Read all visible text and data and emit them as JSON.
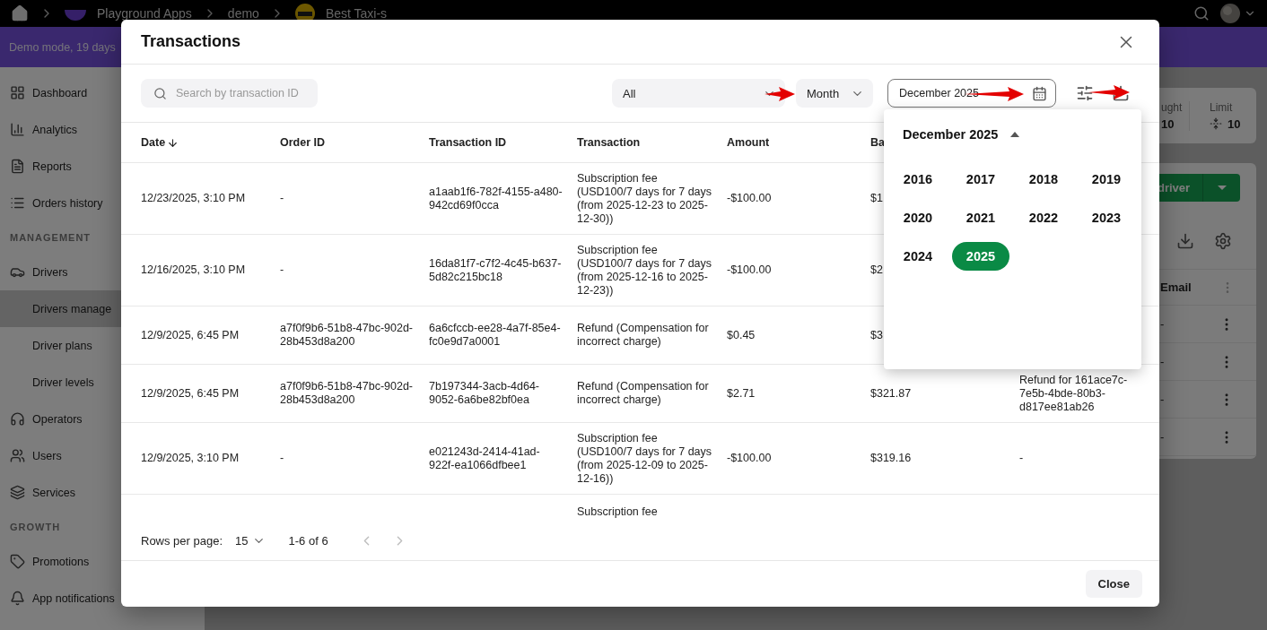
{
  "topbar": {
    "breadcrumbs": [
      {
        "label": "Playground Apps",
        "kind": "org"
      },
      {
        "label": "demo",
        "kind": "text"
      },
      {
        "label": "Best Taxi-s",
        "kind": "app"
      }
    ]
  },
  "banner": {
    "text": "Demo mode, 19 days"
  },
  "sidebar": {
    "items": [
      {
        "kind": "item",
        "label": "Dashboard",
        "selected": false
      },
      {
        "kind": "item",
        "label": "Analytics",
        "selected": false
      },
      {
        "kind": "item",
        "label": "Reports",
        "selected": false
      },
      {
        "kind": "item",
        "label": "Orders history",
        "selected": false
      },
      {
        "kind": "heading",
        "label": "MANAGEMENT"
      },
      {
        "kind": "item",
        "label": "Drivers",
        "selected": false
      },
      {
        "kind": "subitem",
        "label": "Drivers manage",
        "selected": true
      },
      {
        "kind": "subitem",
        "label": "Driver plans",
        "selected": false
      },
      {
        "kind": "subitem",
        "label": "Driver levels",
        "selected": false
      },
      {
        "kind": "item",
        "label": "Operators",
        "selected": false
      },
      {
        "kind": "item",
        "label": "Users",
        "selected": false
      },
      {
        "kind": "item",
        "label": "Services",
        "selected": false
      },
      {
        "kind": "heading",
        "label": "GROWTH"
      },
      {
        "kind": "item",
        "label": "Promotions",
        "selected": false
      },
      {
        "kind": "item",
        "label": "App notifications",
        "selected": false
      }
    ]
  },
  "background": {
    "stats": [
      {
        "kind": "count",
        "label": "ught",
        "value": "10"
      },
      {
        "kind": "limit",
        "label": "Limit",
        "value": "10"
      }
    ],
    "add_button": {
      "label": "driver"
    },
    "table": {
      "column": "Email",
      "rows": [
        {
          "email": "-"
        },
        {
          "email": "-"
        },
        {
          "email": "-"
        },
        {
          "email": "-"
        }
      ]
    }
  },
  "dialog": {
    "title": "Transactions",
    "search": {
      "placeholder": "Search by transaction ID"
    },
    "type_filter": {
      "value": "All"
    },
    "period_filter": {
      "value": "Month"
    },
    "date_field": {
      "value": "December 2025"
    },
    "columns": [
      {
        "label": "Date",
        "sorted": true
      },
      {
        "label": "Order ID"
      },
      {
        "label": "Transaction ID"
      },
      {
        "label": "Transaction"
      },
      {
        "label": "Amount"
      },
      {
        "label": "Ba"
      }
    ],
    "rows": [
      {
        "date": "12/23/2025, 3:10 PM",
        "order_id": "-",
        "transaction_id": "a1aab1f6-782f-4155-a480-942cd69f0cca",
        "transaction": "Subscription fee (USD100/7 days for 7 days (from 2025-12-23 to 2025-12-30))",
        "amount": "-$100.00",
        "balance": "$1"
      },
      {
        "date": "12/16/2025, 3:10 PM",
        "order_id": "-",
        "transaction_id": "16da81f7-c7f2-4c45-b637-5d82c215bc18",
        "transaction": "Subscription fee (USD100/7 days for 7 days (from 2025-12-16 to 2025-12-23))",
        "amount": "-$100.00",
        "balance": "$2"
      },
      {
        "date": "12/9/2025, 6:45 PM",
        "order_id": "a7f0f9b6-51b8-47bc-902d-28b453d8a200",
        "transaction_id": "6a6cfccb-ee28-4a7f-85e4-fc0e9d7a0001",
        "transaction": "Refund (Compensation for incorrect charge)",
        "amount": "$0.45",
        "balance": "$3"
      },
      {
        "date": "12/9/2025, 6:45 PM",
        "order_id": "a7f0f9b6-51b8-47bc-902d-28b453d8a200",
        "transaction_id": "7b197344-3acb-4d64-9052-6a6be82bf0ea",
        "transaction": "Refund (Compensation for incorrect charge)",
        "amount": "$2.71",
        "balance": "$321.87",
        "column_7": "Refund for 161ace7c-7e5b-4bde-80b3-d817ee81ab26"
      },
      {
        "date": "12/9/2025, 3:10 PM",
        "order_id": "-",
        "transaction_id": "e021243d-2414-41ad-922f-ea1066dfbee1",
        "transaction": "Subscription fee (USD100/7 days for 7 days (from 2025-12-09 to 2025-12-16))",
        "amount": "-$100.00",
        "balance": "$319.16",
        "column_7": "-"
      },
      {
        "transaction": "Subscription fee"
      }
    ],
    "pagination": {
      "rows_label": "Rows per page:",
      "rows_value": "15",
      "range": "1-6 of 6",
      "prev_disabled": true,
      "next_disabled": true
    },
    "date_picker": {
      "header": "December 2025",
      "years": [
        {
          "label": "2016",
          "selected": false
        },
        {
          "label": "2017",
          "selected": false
        },
        {
          "label": "2018",
          "selected": false
        },
        {
          "label": "2019",
          "selected": false
        },
        {
          "label": "2020",
          "selected": false
        },
        {
          "label": "2021",
          "selected": false
        },
        {
          "label": "2022",
          "selected": false
        },
        {
          "label": "2023",
          "selected": false
        },
        {
          "label": "2024",
          "selected": false
        },
        {
          "label": "2025",
          "selected": true
        }
      ]
    },
    "close_button": "Close"
  }
}
